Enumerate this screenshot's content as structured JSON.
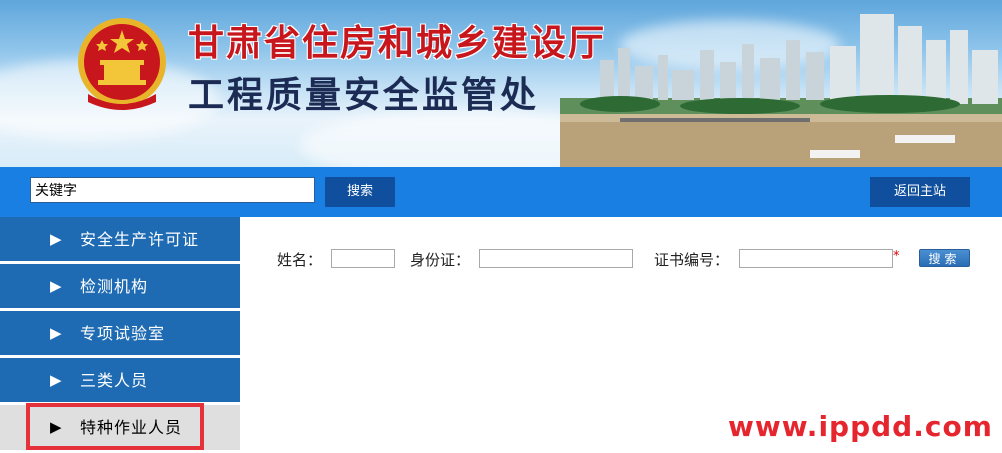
{
  "header": {
    "title_main": "甘肃省住房和城乡建设厅",
    "title_sub": "工程质量安全监管处",
    "emblem_icon": "national-emblem-icon"
  },
  "searchbar": {
    "keyword_value": "关键字",
    "search_label": "搜索",
    "home_label": "返回主站"
  },
  "sidebar": {
    "items": [
      {
        "label": "安全生产许可证",
        "arrow": "▶"
      },
      {
        "label": "检测机构",
        "arrow": "▶"
      },
      {
        "label": "专项试验室",
        "arrow": "▶"
      },
      {
        "label": "三类人员",
        "arrow": "▶"
      },
      {
        "label": "特种作业人员",
        "arrow": "▶"
      }
    ],
    "active_index": 4
  },
  "query_form": {
    "name_label": "姓名：",
    "id_label": "身份证：",
    "cert_label": "证书编号：",
    "required_mark": "*",
    "search_label": "搜索"
  },
  "watermark": "www.ippdd.com",
  "colors": {
    "bar_blue": "#1a7fe3",
    "nav_blue": "#1e6bb3",
    "button_dark": "#0f4f9e",
    "title_red": "#c8161d",
    "title_navy": "#1c2b53",
    "highlight_red": "#e5323a"
  }
}
